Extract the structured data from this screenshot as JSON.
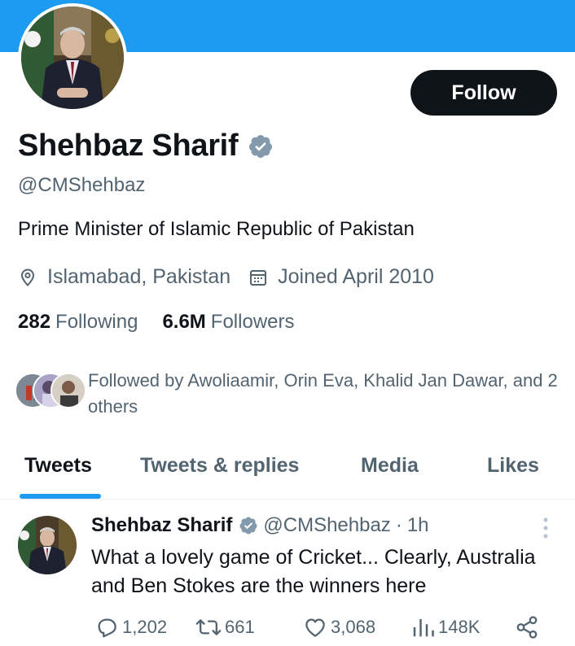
{
  "profile": {
    "name": "Shehbaz Sharif",
    "handle": "@CMShehbaz",
    "bio": "Prime Minister of Islamic Republic of Pakistan",
    "location": "Islamabad, Pakistan",
    "joined": "Joined April 2010",
    "following_count": "282",
    "following_label": "Following",
    "followers_count": "6.6M",
    "followers_label": "Followers",
    "followed_by": "Followed by Awoliaamir, Orin Eva, Khalid Jan Dawar, and 2 others",
    "follow_label": "Follow"
  },
  "tabs": [
    {
      "label": "Tweets",
      "active": true
    },
    {
      "label": "Tweets & replies",
      "active": false
    },
    {
      "label": "Media",
      "active": false
    },
    {
      "label": "Likes",
      "active": false
    }
  ],
  "tweet": {
    "name": "Shehbaz Sharif",
    "handle": "@CMShehbaz",
    "dot": "·",
    "time": "1h",
    "text": "What a lovely game of Cricket... Clearly, Australia and Ben Stokes are the winners here",
    "replies": "1,202",
    "retweets": "661",
    "likes": "3,068",
    "views": "148K"
  },
  "icons": {
    "verified": "verified-badge-icon",
    "location": "location-pin-icon",
    "calendar": "calendar-icon",
    "more": "more-vertical-icon",
    "reply": "reply-icon",
    "retweet": "retweet-icon",
    "like": "heart-icon",
    "views": "views-chart-icon",
    "share": "share-icon"
  },
  "colors": {
    "banner": "#1d9bf0",
    "accent": "#1d9bf0",
    "text_primary": "#0f1419",
    "text_secondary": "#536471",
    "verified_badge": "#829aab"
  }
}
